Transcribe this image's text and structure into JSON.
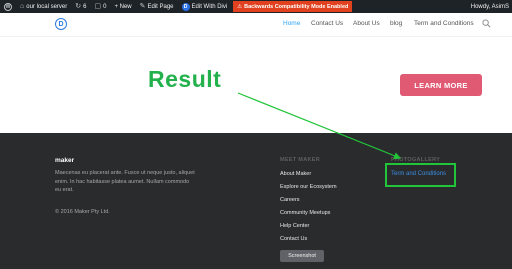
{
  "adminbar": {
    "site_name": "our local server",
    "updates_count": "6",
    "comments_count": "0",
    "new_label": "+ New",
    "edit_page_label": "Edit Page",
    "edit_divi_label": "Edit With Divi",
    "warning_label": "Backwards Compatibility Mode Enabled",
    "howdy": "Howdy, AsimS"
  },
  "header": {
    "logo_letter": "D",
    "nav": [
      "Home",
      "Contact Us",
      "About Us",
      "blog",
      "Term and Conditions"
    ],
    "active_nav": "Home"
  },
  "annotation": {
    "result_text": "Result",
    "color": "#22b14c"
  },
  "hero": {
    "cta_label": "LEARN MORE",
    "cta_color": "#e05a73"
  },
  "footer": {
    "brand": "maker",
    "about_text": "Maecenas eu placerat ante. Fusce ut neque justo, aliquet enim. In hac habitasse platea aumet. Nullam commodo eu erat.",
    "copyright": "© 2016 Maker Pty Ltd.",
    "meet_heading": "MEET MAKER",
    "meet_links": [
      "About Maker",
      "Explore our Ecosystem",
      "Careers",
      "Community Meetups",
      "Help Center",
      "Contact Us"
    ],
    "gallery_heading": "PHOTOGALLERY",
    "term_link": "Term and Conditions",
    "link_color": "#3b8fe6"
  },
  "tooltip": "Screenshot"
}
